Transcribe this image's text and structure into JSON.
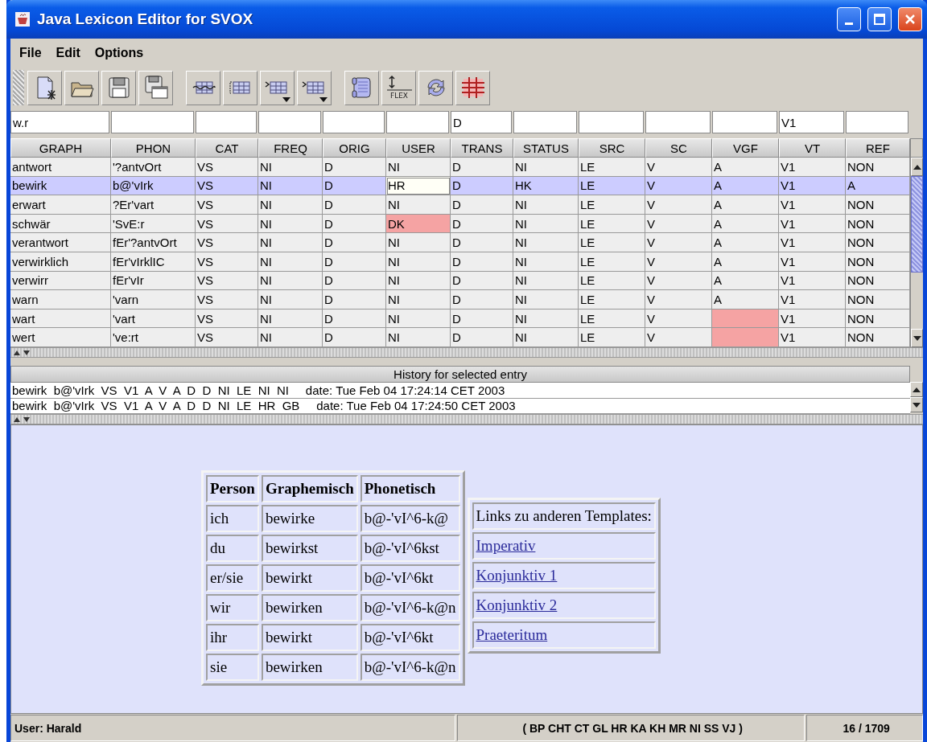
{
  "window": {
    "title": "Java Lexicon Editor for SVOX"
  },
  "menu": [
    "File",
    "Edit",
    "Options"
  ],
  "toolbar": {
    "groups": [
      {
        "buttons": [
          {
            "kind": "new-document",
            "dropdown": false
          },
          {
            "kind": "open-folder",
            "dropdown": false
          },
          {
            "kind": "save",
            "dropdown": false
          },
          {
            "kind": "save-as",
            "dropdown": false
          }
        ]
      },
      {
        "buttons": [
          {
            "kind": "table-wave",
            "dropdown": false
          },
          {
            "kind": "table-bracket",
            "dropdown": false
          },
          {
            "kind": "table-insert",
            "dropdown": true
          },
          {
            "kind": "table-append",
            "dropdown": true
          }
        ]
      },
      {
        "buttons": [
          {
            "kind": "scroll",
            "dropdown": false
          },
          {
            "kind": "flex",
            "label": "FLEX",
            "dropdown": false
          },
          {
            "kind": "refresh",
            "dropdown": false
          },
          {
            "kind": "grid",
            "dropdown": false
          }
        ]
      }
    ]
  },
  "filters": [
    {
      "kind": "filled",
      "value": "w.r"
    },
    {
      "kind": "empty"
    },
    {
      "kind": "empty"
    },
    {
      "kind": "empty"
    },
    {
      "kind": "empty"
    },
    {
      "kind": "empty"
    },
    {
      "kind": "filled",
      "value": "D"
    },
    {
      "kind": "empty"
    },
    {
      "kind": "empty"
    },
    {
      "kind": "empty"
    },
    {
      "kind": "empty"
    },
    {
      "kind": "filled",
      "value": "V1"
    },
    {
      "kind": "empty"
    }
  ],
  "table": {
    "columns": [
      "GRAPH",
      "PHON",
      "CAT",
      "FREQ",
      "ORIG",
      "USER",
      "TRANS",
      "STATUS",
      "SRC",
      "SC",
      "VGF",
      "VT",
      "REF"
    ],
    "rows": [
      {
        "selected": false,
        "cells": [
          "antwort",
          "'?antvOrt",
          "VS",
          "NI",
          "D",
          "NI",
          "D",
          "NI",
          "LE",
          "V",
          "A",
          "V1",
          "NON"
        ]
      },
      {
        "selected": true,
        "cells": [
          "bewirk",
          "b@'vIrk",
          "VS",
          "NI",
          "D",
          {
            "kind": "editing",
            "text": "HR"
          },
          "D",
          "HK",
          "LE",
          "V",
          "A",
          "V1",
          "A"
        ]
      },
      {
        "selected": false,
        "cells": [
          "erwart",
          "?Er'vart",
          "VS",
          "NI",
          "D",
          "NI",
          "D",
          "NI",
          "LE",
          "V",
          "A",
          "V1",
          "NON"
        ]
      },
      {
        "selected": false,
        "cells": [
          "schwär",
          "'SvE:r",
          "VS",
          "NI",
          "D",
          {
            "kind": "error",
            "text": "DK"
          },
          "D",
          "NI",
          "LE",
          "V",
          "A",
          "V1",
          "NON"
        ]
      },
      {
        "selected": false,
        "cells": [
          "verantwort",
          "fEr'?antvOrt",
          "VS",
          "NI",
          "D",
          "NI",
          "D",
          "NI",
          "LE",
          "V",
          "A",
          "V1",
          "NON"
        ]
      },
      {
        "selected": false,
        "cells": [
          "verwirklich",
          "fEr'vIrklIC",
          "VS",
          "NI",
          "D",
          "NI",
          "D",
          "NI",
          "LE",
          "V",
          "A",
          "V1",
          "NON"
        ]
      },
      {
        "selected": false,
        "cells": [
          "verwirr",
          "fEr'vIr",
          "VS",
          "NI",
          "D",
          "NI",
          "D",
          "NI",
          "LE",
          "V",
          "A",
          "V1",
          "NON"
        ]
      },
      {
        "selected": false,
        "cells": [
          "warn",
          "'varn",
          "VS",
          "NI",
          "D",
          "NI",
          "D",
          "NI",
          "LE",
          "V",
          "A",
          "V1",
          "NON"
        ]
      },
      {
        "selected": false,
        "cells": [
          "wart",
          "'vart",
          "VS",
          "NI",
          "D",
          "NI",
          "D",
          "NI",
          "LE",
          "V",
          {
            "kind": "error"
          },
          "V1",
          "NON"
        ]
      },
      {
        "selected": false,
        "cells": [
          "wert",
          "'ve:rt",
          "VS",
          "NI",
          "D",
          "NI",
          "D",
          "NI",
          "LE",
          "V",
          {
            "kind": "error"
          },
          "V1",
          "NON"
        ]
      }
    ]
  },
  "history": {
    "title": "History for selected entry",
    "rows": [
      "bewirk  b@'vIrk  VS  V1  A  V  A  D  D  NI  LE  NI  NI     date: Tue Feb 04 17:24:14 CET 2003",
      "bewirk  b@'vIrk  VS  V1  A  V  A  D  D  NI  LE  HR  GB     date: Tue Feb 04 17:24:50 CET 2003"
    ]
  },
  "preview": {
    "conjugation": {
      "columns": [
        "Person",
        "Graphemisch",
        "Phonetisch"
      ],
      "rows": [
        [
          "ich",
          "bewirke",
          "b@-'vI^6-k@"
        ],
        [
          "du",
          "bewirkst",
          "b@-'vI^6kst"
        ],
        [
          "er/sie",
          "bewirkt",
          "b@-'vI^6kt"
        ],
        [
          "wir",
          "bewirken",
          "b@-'vI^6-k@n"
        ],
        [
          "ihr",
          "bewirkt",
          "b@-'vI^6kt"
        ],
        [
          "sie",
          "bewirken",
          "b@-'vI^6-k@n"
        ]
      ]
    },
    "links": {
      "title": "Links zu anderen Templates:",
      "items": [
        "Imperativ",
        "Konjunktiv 1",
        "Konjunktiv 2",
        "Praeteritum"
      ]
    }
  },
  "status_bar": {
    "user": "User: Harald",
    "groups": "( BP CHT CT GL HR KA KH MR NI SS VJ )",
    "position": "16 / 1709"
  }
}
